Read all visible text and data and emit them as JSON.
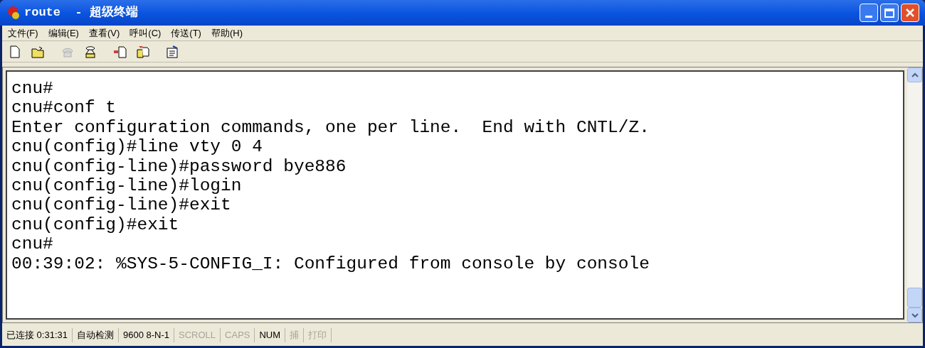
{
  "window": {
    "title": "route  - 超级终端"
  },
  "menu": [
    {
      "label": "文件(F)"
    },
    {
      "label": "编辑(E)"
    },
    {
      "label": "查看(V)"
    },
    {
      "label": "呼叫(C)"
    },
    {
      "label": "传送(T)"
    },
    {
      "label": "帮助(H)"
    }
  ],
  "toolbar": [
    {
      "kind": "new",
      "disabled": false
    },
    {
      "kind": "open",
      "disabled": false
    },
    {
      "kind": "gap"
    },
    {
      "kind": "phone",
      "disabled": true
    },
    {
      "kind": "dial",
      "disabled": false
    },
    {
      "kind": "gap"
    },
    {
      "kind": "send",
      "disabled": false
    },
    {
      "kind": "receive",
      "disabled": false
    },
    {
      "kind": "gap"
    },
    {
      "kind": "properties",
      "disabled": false
    }
  ],
  "terminal": {
    "lines": [
      "cnu#",
      "cnu#conf t",
      "Enter configuration commands, one per line.  End with CNTL/Z.",
      "cnu(config)#line vty 0 4",
      "cnu(config-line)#password bye886",
      "cnu(config-line)#login",
      "cnu(config-line)#exit",
      "cnu(config)#exit",
      "cnu#",
      "00:39:02: %SYS-5-CONFIG_I: Configured from console by console"
    ]
  },
  "status_bar": [
    {
      "text": "已连接 0:31:31",
      "disabled": false
    },
    {
      "text": "自动检测",
      "disabled": false
    },
    {
      "text": "9600 8-N-1",
      "disabled": false
    },
    {
      "text": "SCROLL",
      "disabled": true
    },
    {
      "text": "CAPS",
      "disabled": true
    },
    {
      "text": "NUM",
      "disabled": false
    },
    {
      "text": "捕",
      "disabled": true
    },
    {
      "text": "打印",
      "disabled": true
    }
  ]
}
